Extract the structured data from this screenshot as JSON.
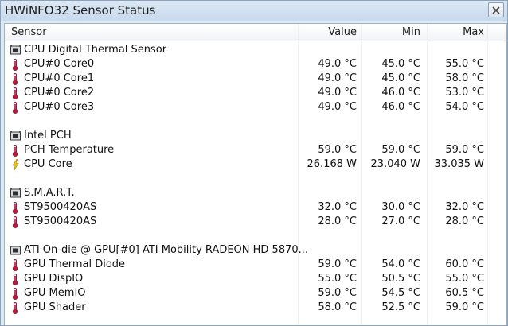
{
  "window": {
    "title": "HWiNFO32 Sensor Status"
  },
  "columns": {
    "sensor": "Sensor",
    "value": "Value",
    "min": "Min",
    "max": "Max"
  },
  "rows": [
    {
      "type": "group",
      "label": "CPU Digital Thermal Sensor",
      "icon": "chip-icon"
    },
    {
      "type": "sensor",
      "label": "CPU#0 Core0",
      "value": "49.0 °C",
      "min": "45.0 °C",
      "max": "55.0 °C",
      "icon": "thermometer-icon"
    },
    {
      "type": "sensor",
      "label": "CPU#0 Core1",
      "value": "49.0 °C",
      "min": "45.0 °C",
      "max": "58.0 °C",
      "icon": "thermometer-icon"
    },
    {
      "type": "sensor",
      "label": "CPU#0 Core2",
      "value": "49.0 °C",
      "min": "46.0 °C",
      "max": "53.0 °C",
      "icon": "thermometer-icon"
    },
    {
      "type": "sensor",
      "label": "CPU#0 Core3",
      "value": "49.0 °C",
      "min": "46.0 °C",
      "max": "54.0 °C",
      "icon": "thermometer-icon"
    },
    {
      "type": "blank"
    },
    {
      "type": "group",
      "label": "Intel PCH",
      "icon": "chip-icon"
    },
    {
      "type": "sensor",
      "label": "PCH Temperature",
      "value": "59.0 °C",
      "min": "59.0 °C",
      "max": "59.0 °C",
      "icon": "thermometer-icon"
    },
    {
      "type": "sensor",
      "label": "CPU Core",
      "value": "26.168 W",
      "min": "23.040 W",
      "max": "33.035 W",
      "icon": "lightning-bolt-icon"
    },
    {
      "type": "blank"
    },
    {
      "type": "group",
      "label": "S.M.A.R.T.",
      "icon": "chip-icon"
    },
    {
      "type": "sensor",
      "label": "ST9500420AS",
      "value": "32.0 °C",
      "min": "30.0 °C",
      "max": "32.0 °C",
      "icon": "thermometer-icon"
    },
    {
      "type": "sensor",
      "label": "ST9500420AS",
      "value": "28.0 °C",
      "min": "27.0 °C",
      "max": "28.0 °C",
      "icon": "thermometer-icon"
    },
    {
      "type": "blank"
    },
    {
      "type": "group",
      "label": "ATI On-die @ GPU[#0] ATI Mobility RADEON HD 5870...",
      "icon": "chip-icon"
    },
    {
      "type": "sensor",
      "label": "GPU Thermal Diode",
      "value": "59.0 °C",
      "min": "54.0 °C",
      "max": "60.0 °C",
      "icon": "thermometer-icon"
    },
    {
      "type": "sensor",
      "label": "GPU DispIO",
      "value": "55.0 °C",
      "min": "50.5 °C",
      "max": "55.0 °C",
      "icon": "thermometer-icon"
    },
    {
      "type": "sensor",
      "label": "GPU MemIO",
      "value": "59.0 °C",
      "min": "54.5 °C",
      "max": "60.5 °C",
      "icon": "thermometer-icon"
    },
    {
      "type": "sensor",
      "label": "GPU Shader",
      "value": "58.0 °C",
      "min": "52.5 °C",
      "max": "59.0 °C",
      "icon": "thermometer-icon"
    }
  ]
}
